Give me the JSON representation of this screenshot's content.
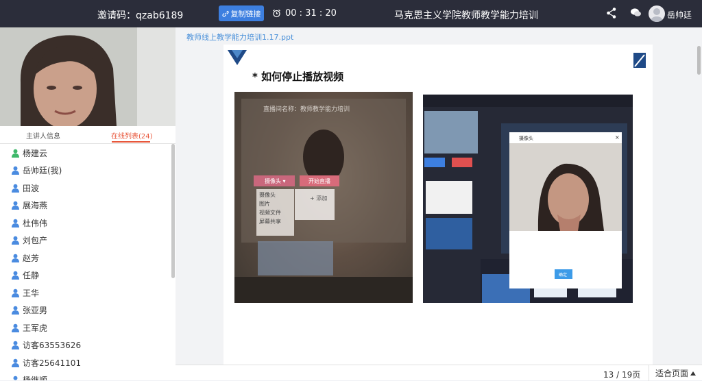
{
  "header": {
    "invite_label": "邀请码：",
    "invite_code": "qzab6189",
    "copy_link_label": "复制链接",
    "timer": "00 : 31 : 20",
    "title": "马克思主义学院教师教学能力培训",
    "user_name": "岳帅廷"
  },
  "tabs": {
    "host_info": "主讲人信息",
    "online_list": "在线列表(24)"
  },
  "users": [
    {
      "name": "杨建云",
      "color": "#3fb86b"
    },
    {
      "name": "岳帅廷(我)",
      "color": "#4a8be0"
    },
    {
      "name": "田波",
      "color": "#4a8be0"
    },
    {
      "name": "展海燕",
      "color": "#4a8be0"
    },
    {
      "name": "杜伟伟",
      "color": "#4a8be0"
    },
    {
      "name": "刘包产",
      "color": "#4a8be0"
    },
    {
      "name": "赵芳",
      "color": "#4a8be0"
    },
    {
      "name": "任静",
      "color": "#4a8be0"
    },
    {
      "name": "王华",
      "color": "#4a8be0"
    },
    {
      "name": "张亚男",
      "color": "#4a8be0"
    },
    {
      "name": "王军虎",
      "color": "#4a8be0"
    },
    {
      "name": "访客63553626",
      "color": "#4a8be0"
    },
    {
      "name": "访客25641101",
      "color": "#4a8be0"
    },
    {
      "name": "杨继顺",
      "color": "#4a8be0"
    }
  ],
  "document": {
    "file_name": "教师线上教学能力培训1.17.ppt",
    "slide_heading": "* 如何停止播放视频",
    "photo_caption_room": "直播间名称：教师教学能力培训",
    "photo_menu_items": [
      "摄像头",
      "图片",
      "视频文件",
      "屏幕共享"
    ],
    "photo_btn_camera": "摄像头 ▾",
    "photo_btn_start": "开始直播",
    "photo_add": "+ 添加",
    "dialog_title": "摄像头",
    "dialog_confirm": "确定",
    "page_current": "13",
    "page_total": "19页",
    "fit_page_label": "适合页面"
  },
  "colors": {
    "accent": "#3d7fe0",
    "topbar": "#2b2d3a",
    "active_tab": "#e8563a",
    "link": "#4a90d9"
  },
  "icons": [
    "link-icon",
    "alarm-clock-icon",
    "share-icon",
    "chat-icon",
    "user-icon",
    "caret-up-icon"
  ]
}
